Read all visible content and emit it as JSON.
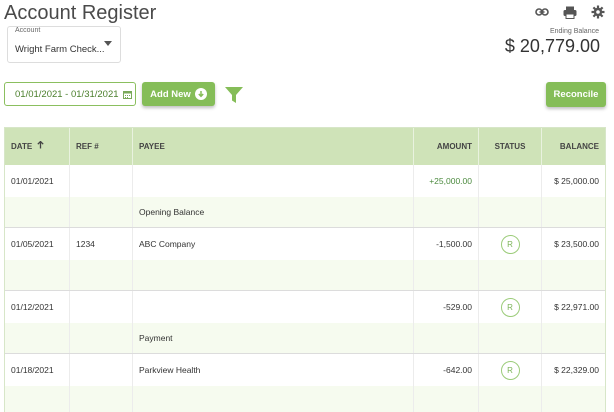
{
  "title": "Account Register",
  "icons": {
    "link": "link-icon",
    "print": "print-icon",
    "settings": "gear-icon"
  },
  "account": {
    "label": "Account",
    "value": "Wright Farm Check..."
  },
  "ending_balance": {
    "label": "Ending Balance",
    "value": "$ 20,779.00"
  },
  "date_range": "01/01/2021 - 01/31/2021",
  "add_new_label": "Add New",
  "reconcile_label": "Reconcile",
  "colors": {
    "accent": "#85bd58",
    "header_bg": "#cfe3b8",
    "sub_row_bg": "#f6fbef"
  },
  "table": {
    "headers": {
      "date": "DATE",
      "ref": "REF #",
      "payee": "PAYEE",
      "amount": "AMOUNT",
      "status": "STATUS",
      "balance": "BALANCE"
    },
    "rows": [
      {
        "date": "01/01/2021",
        "ref": "",
        "payee": "",
        "memo": "Opening Balance",
        "amount": "+25,000.00",
        "status": "",
        "balance": "$ 25,000.00"
      },
      {
        "date": "01/05/2021",
        "ref": "1234",
        "payee": "ABC Company",
        "memo": "",
        "amount": "-1,500.00",
        "status": "R",
        "balance": "$ 23,500.00"
      },
      {
        "date": "01/12/2021",
        "ref": "",
        "payee": "",
        "memo": "Payment",
        "amount": "-529.00",
        "status": "R",
        "balance": "$ 22,971.00"
      },
      {
        "date": "01/18/2021",
        "ref": "",
        "payee": "Parkview Health",
        "memo": "",
        "amount": "-642.00",
        "status": "R",
        "balance": "$ 22,329.00"
      }
    ]
  }
}
